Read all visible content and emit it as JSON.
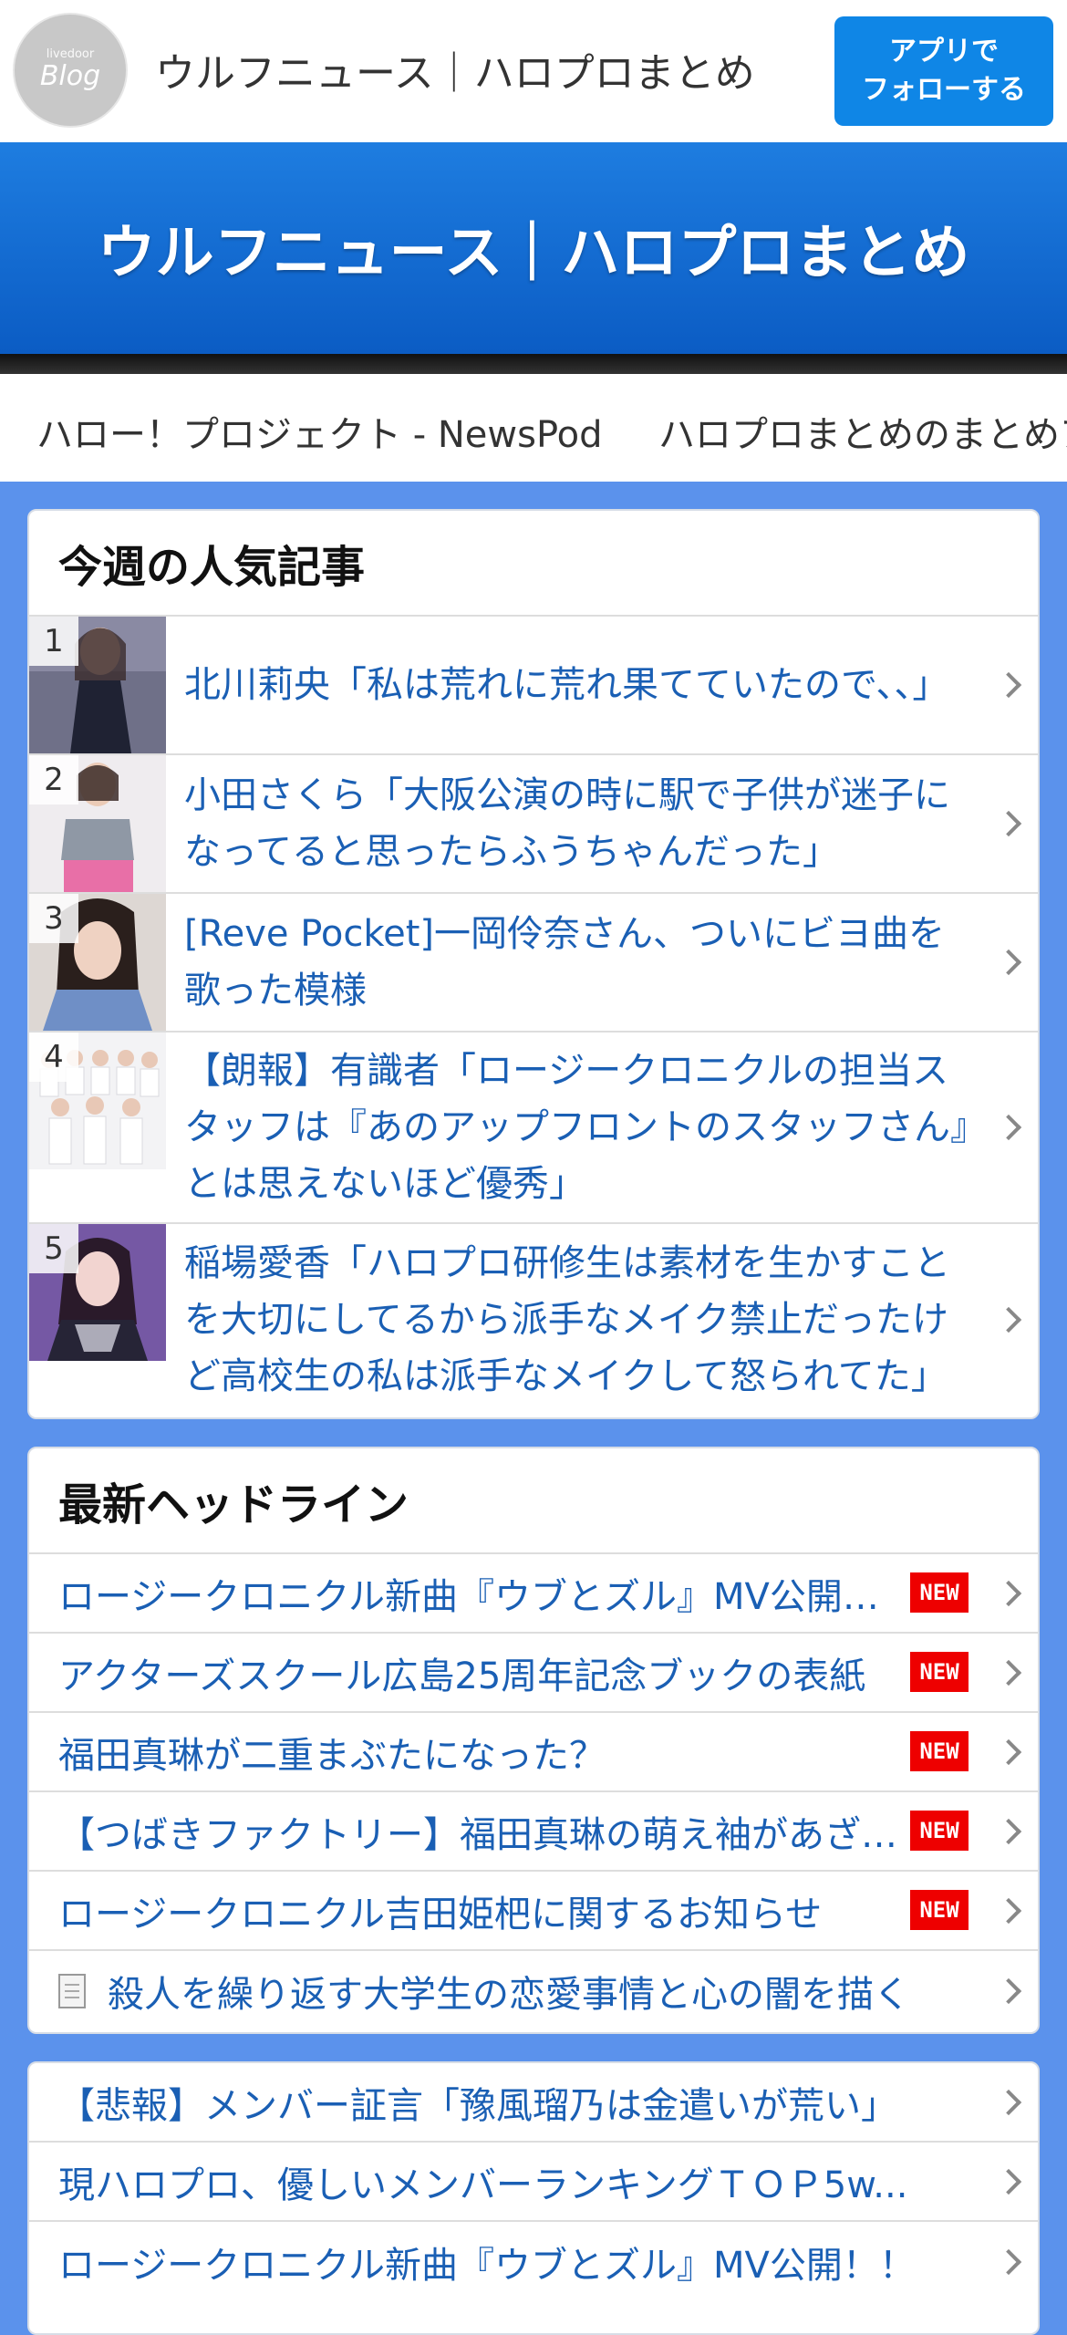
{
  "header": {
    "logo_small": "livedoor",
    "logo_big": "Blog",
    "site_name": "ウルフニュース｜ハロプロまとめ",
    "follow_button": "アプリで\nフォローする"
  },
  "banner": {
    "title": "ウルフニュース｜ハロプロまとめ"
  },
  "links": [
    "ハロー！プロジェクト - NewsPod",
    "ハロプロまとめのまとめア"
  ],
  "popular": {
    "title": "今週の人気記事",
    "items": [
      {
        "rank": "1",
        "title": "北川莉央「私は荒れに荒れ果てていたので、、」"
      },
      {
        "rank": "2",
        "title": "小田さくら「大阪公演の時に駅で子供が迷子になってると思ったらふうちゃんだった」"
      },
      {
        "rank": "3",
        "title": "[Reve Pocket]一岡伶奈さん、ついにビヨ曲を歌った模様"
      },
      {
        "rank": "4",
        "title": "【朗報】有識者「ロージークロニクルの担当スタッフは『あのアップフロントのスタッフさん』とは思えないほど優秀」"
      },
      {
        "rank": "5",
        "title": "稲場愛香「ハロプロ研修生は素材を生かすことを大切にしてるから派手なメイク禁止だったけど高校生の私は派手なメイクして怒られてた」"
      }
    ]
  },
  "headlines": {
    "title": "最新ヘッドライン",
    "badge": "NEW",
    "items": [
      {
        "title": "ロージークロニクル新曲『ウブとズル』MV公開！！"
      },
      {
        "title": "アクターズスクール広島25周年記念ブックの表紙"
      },
      {
        "title": "福田真琳が二重まぶたになった？"
      },
      {
        "title": "【つばきファクトリー】福田真琳の萌え袖があざとい"
      },
      {
        "title": "ロージークロニクル吉田姫杷に関するお知らせ"
      },
      {
        "title": "殺人を繰り返す大学生の恋愛事情と心の闇を描く"
      }
    ]
  },
  "more": {
    "items": [
      {
        "title": "【悲報】メンバー証言「豫風瑠乃は金遣いが荒い」"
      },
      {
        "title": "現ハロプロ、優しいメンバーランキングＴＯＰ5w..."
      },
      {
        "title": "ロージークロニクル新曲『ウブとズル』MV公開！！"
      }
    ]
  },
  "colors": {
    "accent": "#0f86e6",
    "banner": "#1e7de0",
    "link_text": "#1a5fb4",
    "page_bg": "#5b92ec",
    "badge": "#ee0000"
  }
}
